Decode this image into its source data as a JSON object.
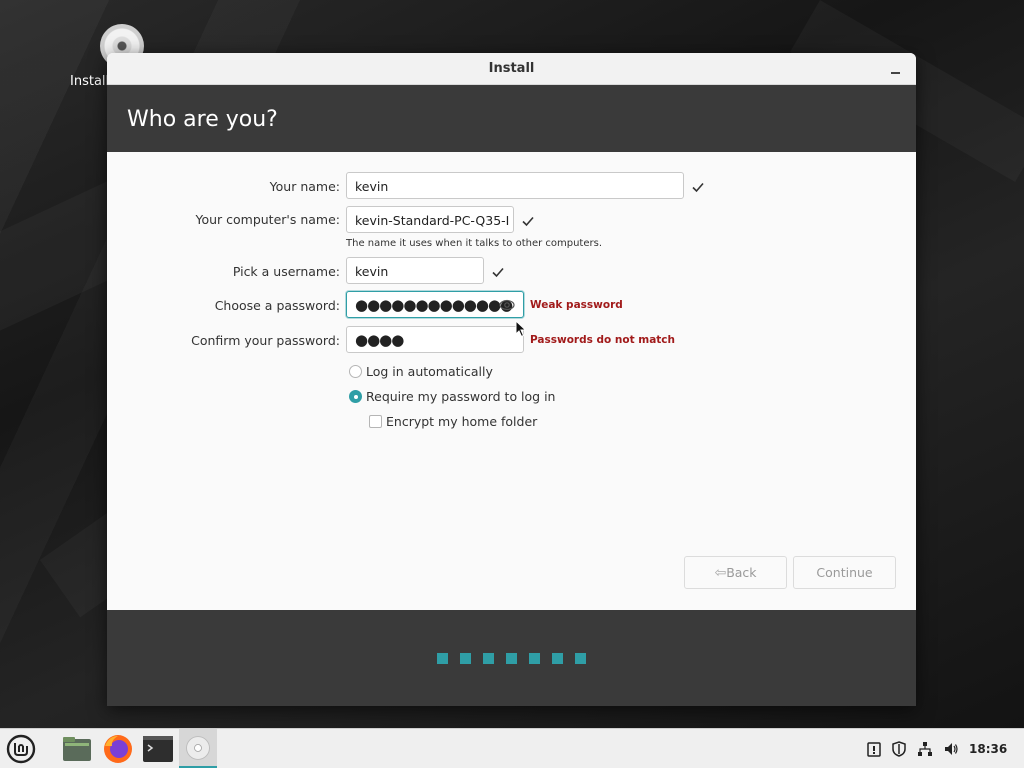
{
  "desktop": {
    "icon_label": "Install"
  },
  "window": {
    "title": "Install",
    "page_title": "Who are you?"
  },
  "form": {
    "name": {
      "label": "Your name:",
      "value": "kevin"
    },
    "computer": {
      "label": "Your computer's name:",
      "value": "kevin-Standard-PC-Q35-I",
      "hint": "The name it uses when it talks to other computers."
    },
    "username": {
      "label": "Pick a username:",
      "value": "kevin"
    },
    "password": {
      "label": "Choose a password:",
      "value": "●●●●●●●●●●●●●",
      "warning": "Weak password"
    },
    "confirm": {
      "label": "Confirm your password:",
      "value": "●●●●",
      "warning": "Passwords do not match"
    },
    "options": {
      "auto_login": "Log in automatically",
      "require_password": "Require my password to log in",
      "encrypt_home": "Encrypt my home folder"
    }
  },
  "buttons": {
    "back": "Back",
    "continue": "Continue"
  },
  "progress": {
    "steps": 7
  },
  "taskbar": {
    "clock": "18:36"
  },
  "colors": {
    "accent": "#2f9ea6",
    "warning": "#a11a1a",
    "header_band": "#3a3a3a"
  }
}
